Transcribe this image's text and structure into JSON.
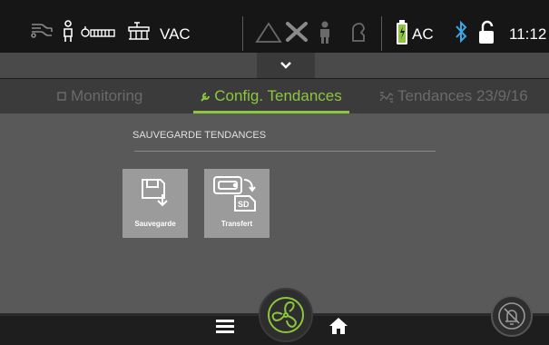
{
  "status": {
    "mode": "VAC",
    "power": "AC",
    "time": "11:12",
    "icons": [
      "circuit-icon",
      "patient-icon",
      "valve-icon",
      "breathing-circuit-icon",
      "alarm-icon",
      "tools-icon",
      "person-icon",
      "mask-icon",
      "battery-icon",
      "bluetooth-icon",
      "unlock-icon"
    ],
    "accent_color": "#8dc63f",
    "bluetooth_color": "#3aa9e9"
  },
  "pulldown": {
    "icon": "chevron-down-icon"
  },
  "tabs": [
    {
      "label": "Monitoring",
      "icon": "square-icon",
      "active": false
    },
    {
      "label": "Config. Tendances",
      "icon": "wrench-icon",
      "active": true
    },
    {
      "label": "Tendances 23/9/16",
      "icon": "trends-icon",
      "active": false
    }
  ],
  "section": {
    "title": "SAUVEGARDE TENDANCES"
  },
  "tiles": [
    {
      "label": "Sauvegarde",
      "icon": "save-icon"
    },
    {
      "label": "Transfert",
      "icon": "sd-card-transfer-icon",
      "sd_text": "SD"
    }
  ],
  "bottom": {
    "icons": [
      "menu-icon",
      "fan-icon",
      "home-icon",
      "alarm-silence-icon"
    ]
  }
}
